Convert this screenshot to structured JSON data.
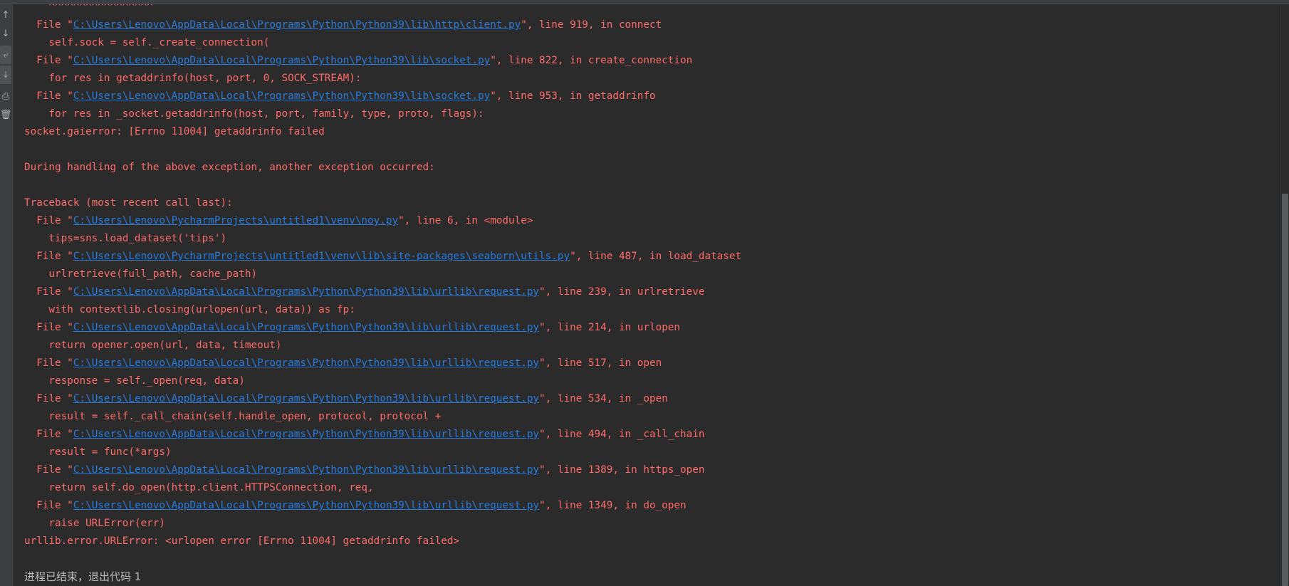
{
  "toolbar": {
    "buttons": [
      {
        "name": "up-arrow-icon",
        "glyph": "↑"
      },
      {
        "name": "down-arrow-icon",
        "glyph": "↓"
      },
      {
        "name": "soft-wrap-icon",
        "glyph": "⤶"
      },
      {
        "name": "scroll-to-end-icon",
        "glyph": "⤓"
      },
      {
        "name": "print-icon",
        "glyph": "⎙"
      },
      {
        "name": "clear-all-icon",
        "glyph": "🗑"
      }
    ]
  },
  "console": {
    "lines": [
      {
        "kind": "partial",
        "text": "    ^^^^^^^^^^^^^^^^^"
      },
      {
        "kind": "file",
        "prefix": "  File \"",
        "path": "C:\\Users\\Lenovo\\AppData\\Local\\Programs\\Python\\Python39\\lib\\http\\client.py",
        "suffix": "\", line 919, in connect"
      },
      {
        "kind": "code",
        "text": "    self.sock = self._create_connection("
      },
      {
        "kind": "file",
        "prefix": "  File \"",
        "path": "C:\\Users\\Lenovo\\AppData\\Local\\Programs\\Python\\Python39\\lib\\socket.py",
        "suffix": "\", line 822, in create_connection"
      },
      {
        "kind": "code",
        "text": "    for res in getaddrinfo(host, port, 0, SOCK_STREAM):"
      },
      {
        "kind": "file",
        "prefix": "  File \"",
        "path": "C:\\Users\\Lenovo\\AppData\\Local\\Programs\\Python\\Python39\\lib\\socket.py",
        "suffix": "\", line 953, in getaddrinfo"
      },
      {
        "kind": "code",
        "text": "    for res in _socket.getaddrinfo(host, port, family, type, proto, flags):"
      },
      {
        "kind": "error",
        "text": "socket.gaierror: [Errno 11004] getaddrinfo failed"
      },
      {
        "kind": "blank",
        "text": ""
      },
      {
        "kind": "error",
        "text": "During handling of the above exception, another exception occurred:"
      },
      {
        "kind": "blank",
        "text": ""
      },
      {
        "kind": "error",
        "text": "Traceback (most recent call last):"
      },
      {
        "kind": "file",
        "prefix": "  File \"",
        "path": "C:\\Users\\Lenovo\\PycharmProjects\\untitled1\\venv\\noy.py",
        "suffix": "\", line 6, in <module>"
      },
      {
        "kind": "code",
        "text": "    tips=sns.load_dataset('tips')"
      },
      {
        "kind": "file",
        "prefix": "  File \"",
        "path": "C:\\Users\\Lenovo\\PycharmProjects\\untitled1\\venv\\lib\\site-packages\\seaborn\\utils.py",
        "suffix": "\", line 487, in load_dataset"
      },
      {
        "kind": "code",
        "text": "    urlretrieve(full_path, cache_path)"
      },
      {
        "kind": "file",
        "prefix": "  File \"",
        "path": "C:\\Users\\Lenovo\\AppData\\Local\\Programs\\Python\\Python39\\lib\\urllib\\request.py",
        "suffix": "\", line 239, in urlretrieve"
      },
      {
        "kind": "code",
        "text": "    with contextlib.closing(urlopen(url, data)) as fp:"
      },
      {
        "kind": "file",
        "prefix": "  File \"",
        "path": "C:\\Users\\Lenovo\\AppData\\Local\\Programs\\Python\\Python39\\lib\\urllib\\request.py",
        "suffix": "\", line 214, in urlopen"
      },
      {
        "kind": "code",
        "text": "    return opener.open(url, data, timeout)"
      },
      {
        "kind": "file",
        "prefix": "  File \"",
        "path": "C:\\Users\\Lenovo\\AppData\\Local\\Programs\\Python\\Python39\\lib\\urllib\\request.py",
        "suffix": "\", line 517, in open"
      },
      {
        "kind": "code",
        "text": "    response = self._open(req, data)"
      },
      {
        "kind": "file",
        "prefix": "  File \"",
        "path": "C:\\Users\\Lenovo\\AppData\\Local\\Programs\\Python\\Python39\\lib\\urllib\\request.py",
        "suffix": "\", line 534, in _open"
      },
      {
        "kind": "code",
        "text": "    result = self._call_chain(self.handle_open, protocol, protocol +"
      },
      {
        "kind": "file",
        "prefix": "  File \"",
        "path": "C:\\Users\\Lenovo\\AppData\\Local\\Programs\\Python\\Python39\\lib\\urllib\\request.py",
        "suffix": "\", line 494, in _call_chain"
      },
      {
        "kind": "code",
        "text": "    result = func(*args)"
      },
      {
        "kind": "file",
        "prefix": "  File \"",
        "path": "C:\\Users\\Lenovo\\AppData\\Local\\Programs\\Python\\Python39\\lib\\urllib\\request.py",
        "suffix": "\", line 1389, in https_open"
      },
      {
        "kind": "code",
        "text": "    return self.do_open(http.client.HTTPSConnection, req,"
      },
      {
        "kind": "file",
        "prefix": "  File \"",
        "path": "C:\\Users\\Lenovo\\AppData\\Local\\Programs\\Python\\Python39\\lib\\urllib\\request.py",
        "suffix": "\", line 1349, in do_open"
      },
      {
        "kind": "code",
        "text": "    raise URLError(err)"
      },
      {
        "kind": "error",
        "text": "urllib.error.URLError: <urlopen error [Errno 11004] getaddrinfo failed>"
      },
      {
        "kind": "blank",
        "text": ""
      },
      {
        "kind": "plain",
        "text": "进程已结束，退出代码 1"
      }
    ]
  },
  "colors": {
    "background": "#2b2b2b",
    "error_text": "#ff6b68",
    "link": "#287bde",
    "plain_text": "#bbbbbb"
  }
}
